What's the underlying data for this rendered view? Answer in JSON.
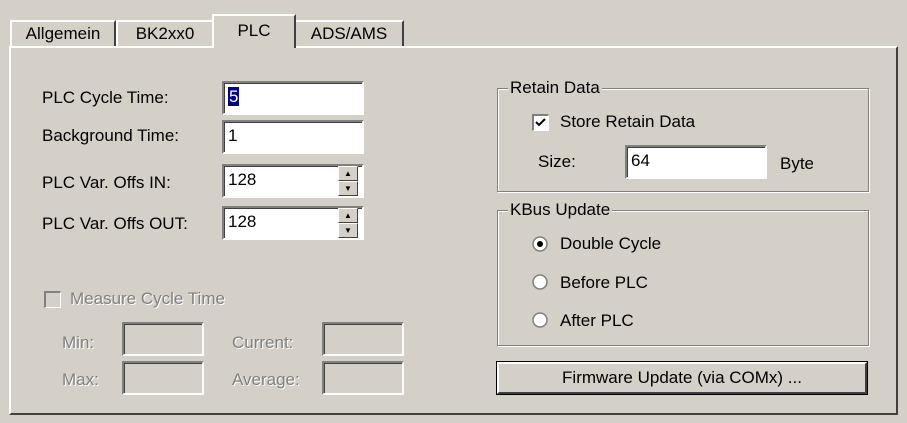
{
  "tabs": [
    "Allgemein",
    "BK2xx0",
    "PLC",
    "ADS/AMS"
  ],
  "plc": {
    "cycle_time_label": "PLC Cycle Time:",
    "cycle_time_value": "5",
    "background_time_label": "Background Time:",
    "background_time_value": "1",
    "offs_in_label": "PLC Var. Offs IN:",
    "offs_in_value": "128",
    "offs_out_label": "PLC Var. Offs OUT:",
    "offs_out_value": "128"
  },
  "measure": {
    "checkbox_label": "Measure Cycle Time",
    "checked": false,
    "enabled": false,
    "min_label": "Min:",
    "max_label": "Max:",
    "current_label": "Current:",
    "average_label": "Average:"
  },
  "retain": {
    "title": "Retain Data",
    "store_label": "Store Retain Data",
    "store_checked": true,
    "size_label": "Size:",
    "size_value": "64",
    "unit": "Byte"
  },
  "kbus": {
    "title": "KBus Update",
    "options": [
      "Double Cycle",
      "Before PLC",
      "After PLC"
    ],
    "selected": "Double Cycle"
  },
  "firmware_button": "Firmware Update (via COMx) ...",
  "colors": {
    "face": "#d4d0c8",
    "selection": "#000080",
    "disabled_text": "#808080"
  }
}
